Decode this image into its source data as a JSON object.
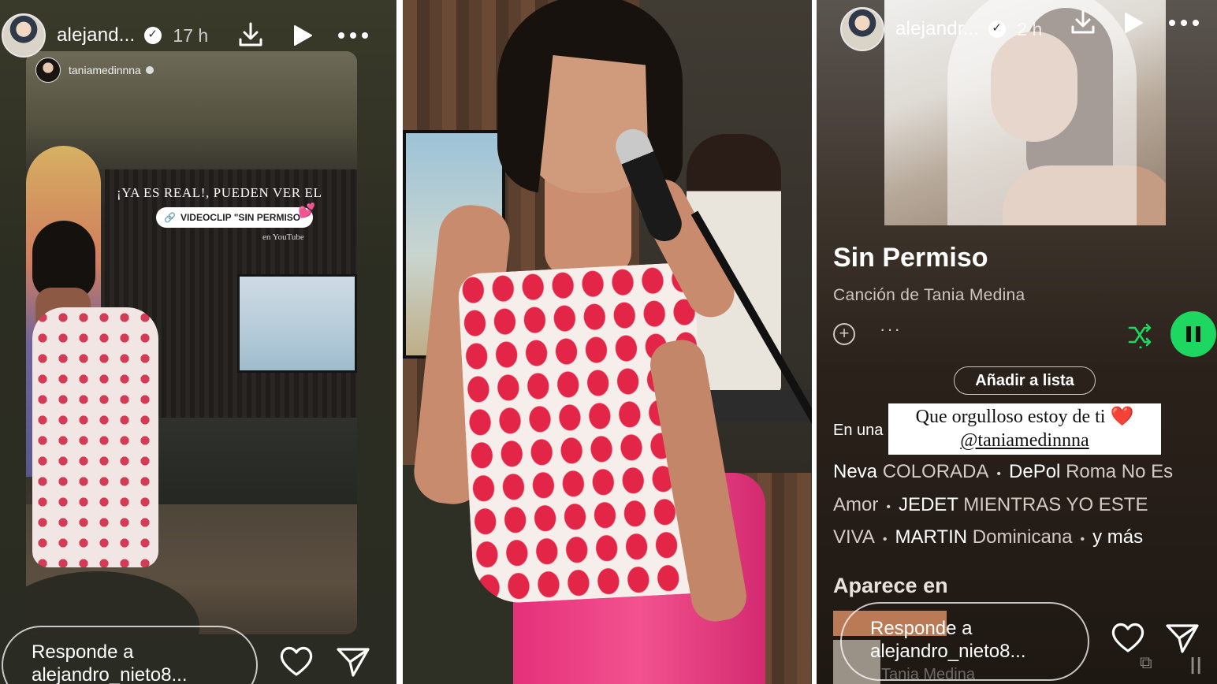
{
  "story1": {
    "username": "alejand...",
    "time": "17 h",
    "inner_username": "taniamedinnna",
    "text_line1": "¡YA ES REAL!, PUEDEN VER EL",
    "pill_label": "VIDEOCLIP \"SIN PERMISO\"",
    "hearts": "💕",
    "youtube_note": "en YouTube",
    "reply_line1": "Responde a",
    "reply_line2": "alejandro_nieto8..."
  },
  "story3": {
    "username": "alejandr...",
    "time": "2 h",
    "song_title": "Sin Permiso",
    "song_subtitle": "Canción de Tania Medina",
    "more_glyph": "···",
    "add_to_list": "Añadir a lista",
    "en_una": "En una",
    "note_line1": "Que orgulloso estoy de ti",
    "note_heart": "❤️",
    "note_mention": "@taniamedinnna",
    "playlists": [
      {
        "curator": "Neva",
        "title": "COLORADA"
      },
      {
        "curator": "DePol",
        "title": "Roma No Es Amor"
      },
      {
        "curator": "JEDET",
        "title": "MIENTRAS YO ESTE VIVA"
      },
      {
        "curator": "MARTIN",
        "title": "Dominicana"
      }
    ],
    "and_more": "y más",
    "appears_in": "Aparece en",
    "ghost_artist": "Tania Medina",
    "reply_line1": "Responde a",
    "reply_line2": "alejandro_nieto8..."
  },
  "colors": {
    "spotify_green": "#1ed760",
    "reply_border": "#ffffff",
    "dress_red": "#e32648"
  },
  "icons": [
    "verified-icon",
    "download-icon",
    "play-icon",
    "more-icon",
    "heart-icon",
    "send-icon",
    "link-icon",
    "add-icon",
    "shuffle-icon",
    "pause-icon"
  ]
}
